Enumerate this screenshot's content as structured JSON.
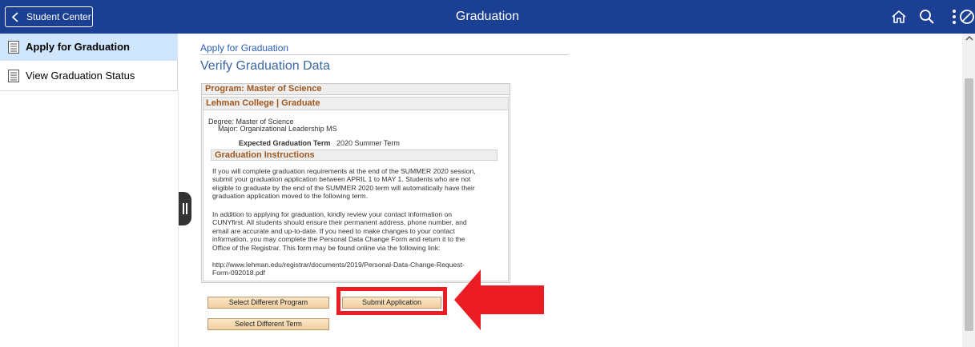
{
  "header": {
    "back_label": "Student Center",
    "title": "Graduation",
    "icons": [
      "home-icon",
      "search-icon",
      "more-options-icon",
      "cancel-icon"
    ]
  },
  "sidebar": {
    "items": [
      {
        "label": "Apply for Graduation",
        "active": true
      },
      {
        "label": "View Graduation Status",
        "active": false
      }
    ]
  },
  "main": {
    "breadcrumb": "Apply for Graduation",
    "title": "Verify Graduation Data",
    "program_header": "Program: Master of Science",
    "college_header": "Lehman College | Graduate",
    "degree": "Degree: Master of Science",
    "major": "Major: Organizational Leadership MS",
    "expected_label": "Expected Graduation Term",
    "expected_value": "2020 Summer Term",
    "instructions_header": "Graduation Instructions",
    "instructions_lines": [
      "If you will complete graduation requirements at the end of the SUMMER 2020 session,",
      "submit your graduation application between APRIL 1 to MAY 1. Students who are not",
      "eligible to graduate by the end of the SUMMER 2020 term will automatically have their",
      "graduation application moved to the following term.",
      "In addition to applying for graduation, kindly review your contact information on",
      "CUNYfirst. All students should ensure their permanent address, phone number, and",
      "email are accurate and up-to-date. If you need to make changes to your contact",
      "information, you may complete the Personal Data Change Form and return it to the",
      "Office of the Registrar. This form may be found online via the following link:",
      "http://www.lehman.edu/registrar/documents/2019/Personal-Data-Change-Request-",
      "Form-092018.pdf"
    ],
    "buttons": {
      "select_program": "Select Different Program",
      "submit": "Submit Application",
      "select_term": "Select Different Term"
    }
  },
  "colors": {
    "header_bg": "#1a3f93",
    "active_item_bg": "#cfe5fb",
    "section_header_text": "#a0571e",
    "highlight": "#ec1c24"
  }
}
